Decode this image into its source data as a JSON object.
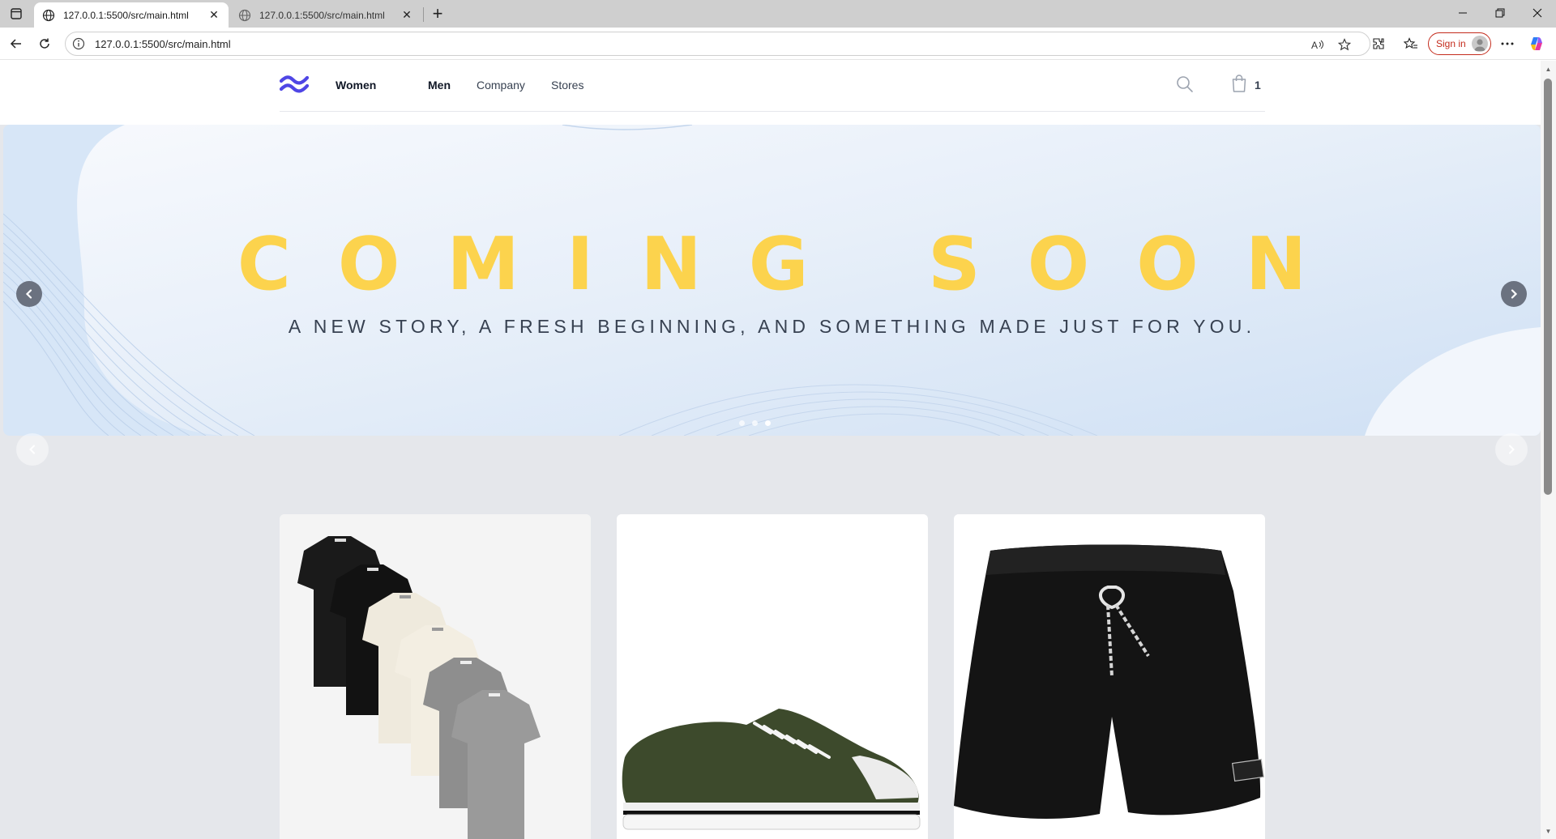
{
  "browser": {
    "tabs": [
      {
        "title": "127.0.0.1:5500/src/main.html",
        "active": true
      },
      {
        "title": "127.0.0.1:5500/src/main.html",
        "active": false
      }
    ],
    "url": "127.0.0.1:5500/src/main.html",
    "signin_label": "Sign in"
  },
  "nav": {
    "links": [
      "Women",
      "Men",
      "Company",
      "Stores"
    ],
    "cart_count": "1"
  },
  "hero": {
    "title": "COMING SOON",
    "subtitle": "A NEW STORY, A FRESH BEGINNING, AND SOMETHING MADE JUST FOR YOU.",
    "slides": 3,
    "active_slide": 3,
    "title_color": "#fcd34d"
  },
  "products": [
    {
      "icon": "tshirts-stack-icon"
    },
    {
      "icon": "sneaker-icon"
    },
    {
      "icon": "shorts-icon"
    }
  ]
}
